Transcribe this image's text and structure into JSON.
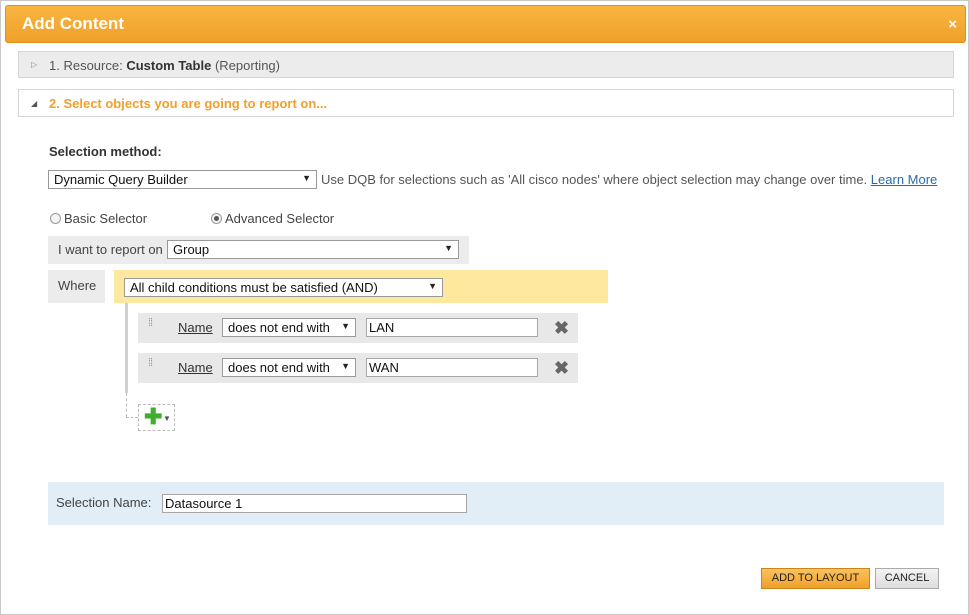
{
  "dialog": {
    "title": "Add Content",
    "close_glyph": "×"
  },
  "steps": {
    "step1": {
      "prefix": "1. Resource:",
      "resource": "Custom Table",
      "suffix": "(Reporting)"
    },
    "step2": {
      "label": "2. Select objects you are going to report on..."
    }
  },
  "selection_method": {
    "label": "Selection method:",
    "value": "Dynamic Query Builder",
    "help_text": "Use DQB for selections such as 'All cisco nodes' where object selection may change over time.",
    "learn_more": "Learn More"
  },
  "selector": {
    "basic_label": "Basic Selector",
    "advanced_label": "Advanced Selector",
    "selected": "advanced"
  },
  "report_on": {
    "label": "I want to report on",
    "value": "Group"
  },
  "where": {
    "label": "Where",
    "condition_mode": "All child conditions must be satisfied (AND)"
  },
  "conditions": [
    {
      "field": "Name",
      "operator": "does not end with",
      "value": "LAN"
    },
    {
      "field": "Name",
      "operator": "does not end with",
      "value": "WAN"
    }
  ],
  "selection_name": {
    "label": "Selection Name:",
    "value": "Datasource 1"
  },
  "buttons": {
    "add_to_layout": "ADD TO LAYOUT",
    "cancel": "CANCEL"
  },
  "colors": {
    "accent": "#f0a02b",
    "and_box": "#fde89e",
    "selname_bg": "#e1eef8",
    "link": "#2b6aa5",
    "plus": "#3fae2a"
  }
}
